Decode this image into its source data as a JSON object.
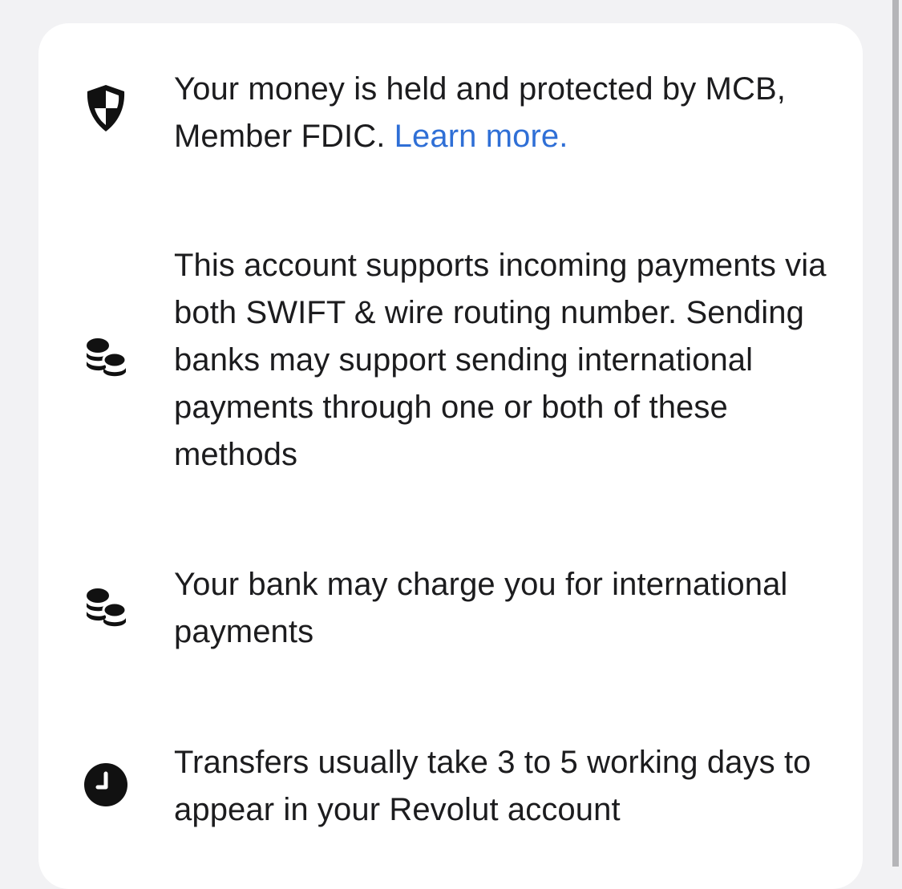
{
  "items": [
    {
      "icon": "shield-icon",
      "text": "Your money is held and protected by MCB, Member FDIC.",
      "link_label": "Learn more."
    },
    {
      "icon": "coins-icon",
      "text": "This account supports incoming payments via both SWIFT & wire routing number. Sending banks may support sending international payments through one or both of these methods"
    },
    {
      "icon": "coins-icon",
      "text": "Your bank may charge you for international payments"
    },
    {
      "icon": "clock-icon",
      "text": "Transfers usually take 3 to 5 working days to appear in your Revolut account"
    }
  ],
  "colors": {
    "background": "#f2f2f4",
    "card": "#ffffff",
    "text": "#1c1c1e",
    "link": "#2f6fd6",
    "icon": "#111111"
  }
}
